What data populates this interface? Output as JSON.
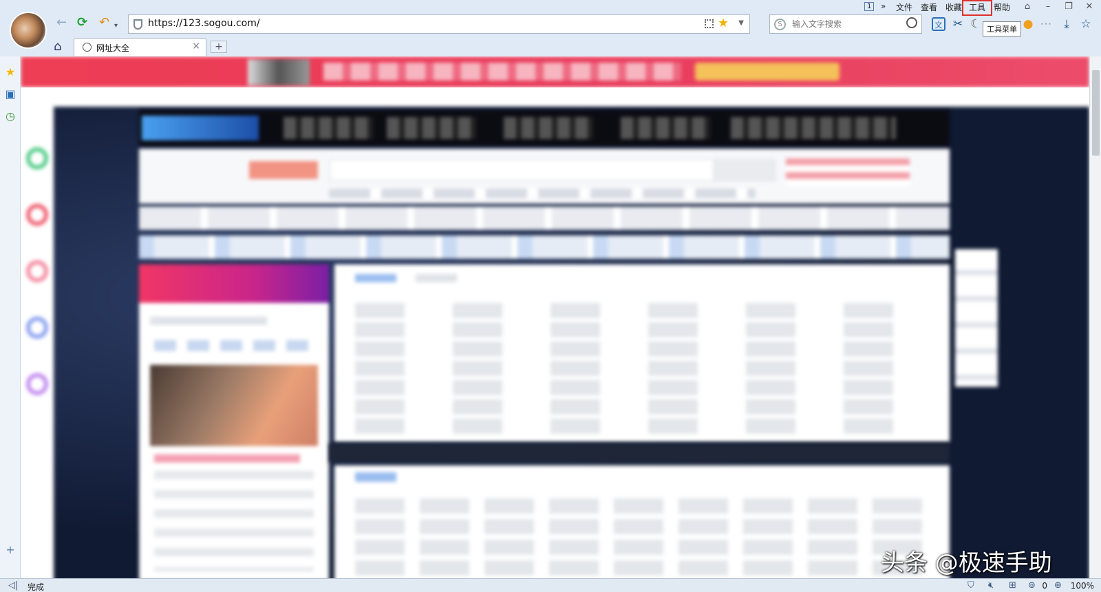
{
  "menubar": {
    "items": [
      "文件",
      "查看",
      "收藏",
      "工具",
      "帮助"
    ],
    "highlighted": "工具",
    "tooltip": "工具菜单",
    "page_indicator": "1",
    "more": "»"
  },
  "address_bar": {
    "url": "https://123.sogou.com/"
  },
  "search_box": {
    "placeholder": "输入文字搜索",
    "logo": "S"
  },
  "tab": {
    "title": "网址大全",
    "close": "×",
    "new_tab": "+"
  },
  "status_bar": {
    "status": "完成",
    "download_count": "0",
    "zoom": "100%"
  },
  "watermark": "头条 @极速手助",
  "icons": {
    "back": "back-arrow-icon",
    "refresh": "refresh-icon",
    "undo": "undo-icon",
    "home": "home-icon",
    "favorite": "star-icon",
    "download": "download-icon",
    "collect": "collect-star-icon"
  },
  "colors": {
    "highlight_border": "#e0302b",
    "banner": "#ee3e55",
    "chrome": "#dfeaf6"
  }
}
